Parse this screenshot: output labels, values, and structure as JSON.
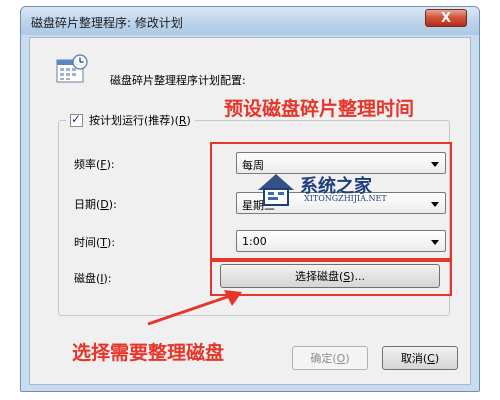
{
  "window": {
    "title": "磁盘碎片整理程序: 修改计划",
    "close_glyph": "X"
  },
  "header": {
    "label": "磁盘碎片整理程序计划配置:",
    "icon": "calendar-clock-icon"
  },
  "schedule_checkbox": {
    "label": "按计划运行(推荐)(",
    "accel": "R",
    "suffix": ")",
    "checked": true
  },
  "fields": {
    "frequency": {
      "label": "频率(",
      "accel": "F",
      "suffix": "):",
      "value": "每周"
    },
    "day": {
      "label": "日期(",
      "accel": "D",
      "suffix": "):",
      "value": "星期三"
    },
    "time": {
      "label": "时间(",
      "accel": "T",
      "suffix": "):",
      "value": "1:00"
    },
    "disk": {
      "label": "磁盘(",
      "accel": "I",
      "suffix": "):"
    }
  },
  "buttons": {
    "select_disks": {
      "label": "选择磁盘(",
      "accel": "S",
      "suffix": ")..."
    },
    "ok": {
      "label": "确定(",
      "accel": "O",
      "suffix": ")"
    },
    "cancel": {
      "label": "取消(",
      "accel": "C",
      "suffix": ")"
    }
  },
  "annotations": {
    "top": "预设磁盘碎片整理时间",
    "bottom": "选择需要整理磁盘",
    "color": "#e8352a"
  },
  "watermark": {
    "text_cn": "系统之家",
    "text_en": "XITONGZHIJIA.NET"
  },
  "colors": {
    "titlebar": "#bcd3ea",
    "client_bg": "#f0f0f0",
    "accent_red": "#e8352a"
  }
}
